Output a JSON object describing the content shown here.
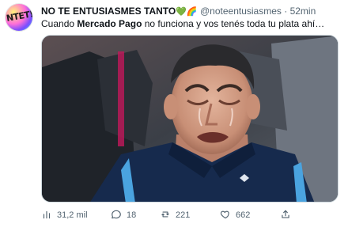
{
  "tweet": {
    "author": {
      "display_name": "NO TE ENTUSIASMES TANTO",
      "name_emojis": "💚🌈",
      "handle": "@noteentusiasmes",
      "separator": "·",
      "time": "52min",
      "avatar_text": "NTET!"
    },
    "text": {
      "before": "Cuando ",
      "bold": "Mercado Pago",
      "after": " no funciona y vos tenés toda tu plata ahí…"
    },
    "actions": {
      "views": "31,2 mil",
      "replies": "18",
      "retweets": "221",
      "likes": "662"
    }
  },
  "colors": {
    "text": "#0f1419",
    "muted": "#536471",
    "border": "#cfd9de",
    "like_heart": "#00ba7c",
    "rainbow": "#ff8a00"
  },
  "icons": {
    "views": "views-bar-chart-icon",
    "reply": "reply-bubble-icon",
    "retweet": "retweet-icon",
    "like": "heart-icon",
    "share": "share-upload-icon"
  }
}
